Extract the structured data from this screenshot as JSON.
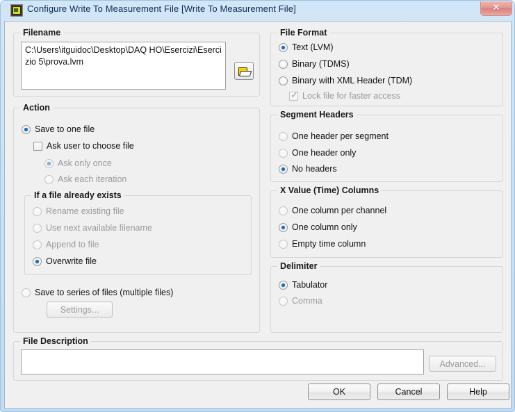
{
  "window": {
    "title": "Configure Write To Measurement File [Write To Measurement File]",
    "icon": "labview-vi-icon",
    "close_label": "✕",
    "accent_selected": "#1c6fc4",
    "titlebar_text_color": "#0b2c52",
    "client_background": "#f0f0f0"
  },
  "filename": {
    "legend": "Filename",
    "value": "C:\\Users\\itguidoc\\Desktop\\DAQ HO\\Esercizi\\Esercizio 5\\prova.lvm",
    "placeholder": "",
    "browse_icon": "folder-open-icon"
  },
  "action": {
    "legend": "Action",
    "save_one_file": {
      "label": "Save to one file",
      "selected": true,
      "enabled": true
    },
    "ask_user": {
      "label": "Ask user to choose file",
      "checked": false,
      "enabled": true
    },
    "ask_only_once": {
      "label": "Ask only once",
      "selected": true,
      "enabled": false
    },
    "ask_each_iteration": {
      "label": "Ask each iteration",
      "selected": false,
      "enabled": false
    },
    "if_exists": {
      "legend": "If a file already exists",
      "options": [
        {
          "label": "Rename existing file",
          "selected": false,
          "enabled": false
        },
        {
          "label": "Use next available filename",
          "selected": false,
          "enabled": false
        },
        {
          "label": "Append to file",
          "selected": false,
          "enabled": false
        },
        {
          "label": "Overwrite file",
          "selected": true,
          "enabled": true
        }
      ]
    },
    "save_series": {
      "label": "Save to series of files (multiple files)",
      "selected": false,
      "enabled": true
    },
    "settings_button": {
      "label": "Settings...",
      "enabled": false
    }
  },
  "file_format": {
    "legend": "File Format",
    "options": [
      {
        "label": "Text (LVM)",
        "selected": true,
        "enabled": true
      },
      {
        "label": "Binary (TDMS)",
        "selected": false,
        "enabled": true
      },
      {
        "label": "Binary with XML Header (TDM)",
        "selected": false,
        "enabled": true
      }
    ],
    "lock_file": {
      "label": "Lock file for faster access",
      "checked": true,
      "enabled": false
    }
  },
  "segment_headers": {
    "legend": "Segment Headers",
    "options": [
      {
        "label": "One header per segment",
        "selected": false,
        "enabled": false
      },
      {
        "label": "One header only",
        "selected": false,
        "enabled": false
      },
      {
        "label": "No headers",
        "selected": true,
        "enabled": true
      }
    ]
  },
  "x_value_columns": {
    "legend": "X Value (Time) Columns",
    "options": [
      {
        "label": "One column per channel",
        "selected": false,
        "enabled": false
      },
      {
        "label": "One column only",
        "selected": true,
        "enabled": true
      },
      {
        "label": "Empty time column",
        "selected": false,
        "enabled": false
      }
    ]
  },
  "delimiter": {
    "legend": "Delimiter",
    "options": [
      {
        "label": "Tabulator",
        "selected": true,
        "enabled": true
      },
      {
        "label": "Comma",
        "selected": false,
        "enabled": false
      }
    ]
  },
  "file_description": {
    "legend": "File Description",
    "value": "",
    "placeholder": "",
    "advanced_button": {
      "label": "Advanced...",
      "enabled": false
    }
  },
  "footer": {
    "ok_label": "OK",
    "cancel_label": "Cancel",
    "help_label": "Help"
  }
}
